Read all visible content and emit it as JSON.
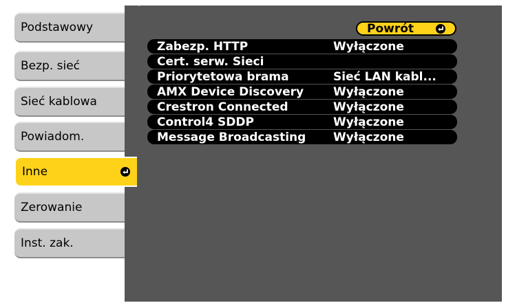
{
  "sidebar": {
    "items": [
      {
        "label": "Podstawowy",
        "active": false
      },
      {
        "label": "Bezp. sieć",
        "active": false
      },
      {
        "label": "Sieć kablowa",
        "active": false
      },
      {
        "label": "Powiadom.",
        "active": false
      },
      {
        "label": "Inne",
        "active": true
      },
      {
        "label": "Zerowanie",
        "active": false
      },
      {
        "label": "Inst. zak.",
        "active": false
      }
    ]
  },
  "main": {
    "back_label": "Powrót",
    "rows": [
      {
        "label": "Zabezp. HTTP",
        "value": "Wyłączone"
      },
      {
        "label": "Cert. serw. Sieci",
        "value": ""
      },
      {
        "label": "Priorytetowa brama",
        "value": "Sieć LAN kabl..."
      },
      {
        "label": "AMX Device Discovery",
        "value": "Wyłączone"
      },
      {
        "label": "Crestron Connected",
        "value": "Wyłączone"
      },
      {
        "label": "Control4 SDDP",
        "value": "Wyłączone"
      },
      {
        "label": "Message Broadcasting",
        "value": "Wyłączone"
      }
    ]
  },
  "colors": {
    "panel_bg": "#565656",
    "tab_bg": "#c7c7c7",
    "highlight": "#ffd21a",
    "row_bg": "#000000",
    "row_text": "#ffffff"
  },
  "icons": {
    "enter": "enter-arrow-icon"
  }
}
